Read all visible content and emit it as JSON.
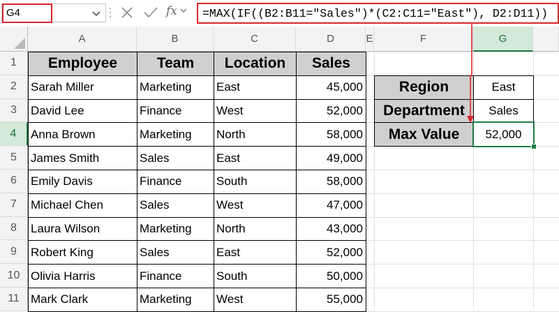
{
  "name_box": {
    "value": "G4"
  },
  "formula_bar": {
    "fx_label": "fx",
    "formula": "=MAX(IF((B2:B11=\"Sales\")*(C2:C11=\"East\"), D2:D11))"
  },
  "columns": [
    "A",
    "B",
    "C",
    "D",
    "E",
    "F",
    "G"
  ],
  "rows": [
    "1",
    "2",
    "3",
    "4",
    "5",
    "6",
    "7",
    "8",
    "9",
    "10",
    "11"
  ],
  "selected_cell": {
    "column": "G",
    "row": "4"
  },
  "table": {
    "headers": [
      "Employee",
      "Team",
      "Location",
      "Sales"
    ],
    "records": [
      [
        "Sarah Miller",
        "Marketing",
        "East",
        "45,000"
      ],
      [
        "David Lee",
        "Finance",
        "West",
        "52,000"
      ],
      [
        "Anna Brown",
        "Marketing",
        "North",
        "58,000"
      ],
      [
        "James Smith",
        "Sales",
        "East",
        "49,000"
      ],
      [
        "Emily Davis",
        "Finance",
        "South",
        "58,000"
      ],
      [
        "Michael Chen",
        "Sales",
        "West",
        "47,000"
      ],
      [
        "Laura Wilson",
        "Marketing",
        "North",
        "43,000"
      ],
      [
        "Robert King",
        "Sales",
        "East",
        "52,000"
      ],
      [
        "Olivia Harris",
        "Finance",
        "South",
        "50,000"
      ],
      [
        "Mark Clark",
        "Marketing",
        "West",
        "55,000"
      ]
    ]
  },
  "criteria": [
    {
      "label": "Region",
      "value": "East"
    },
    {
      "label": "Department",
      "value": "Sales"
    },
    {
      "label": "Max Value",
      "value": "52,000"
    }
  ],
  "colors": {
    "highlight_red": "#d9262b",
    "selection_green": "#1e7b45",
    "header_fill": "#d0d0d0"
  }
}
